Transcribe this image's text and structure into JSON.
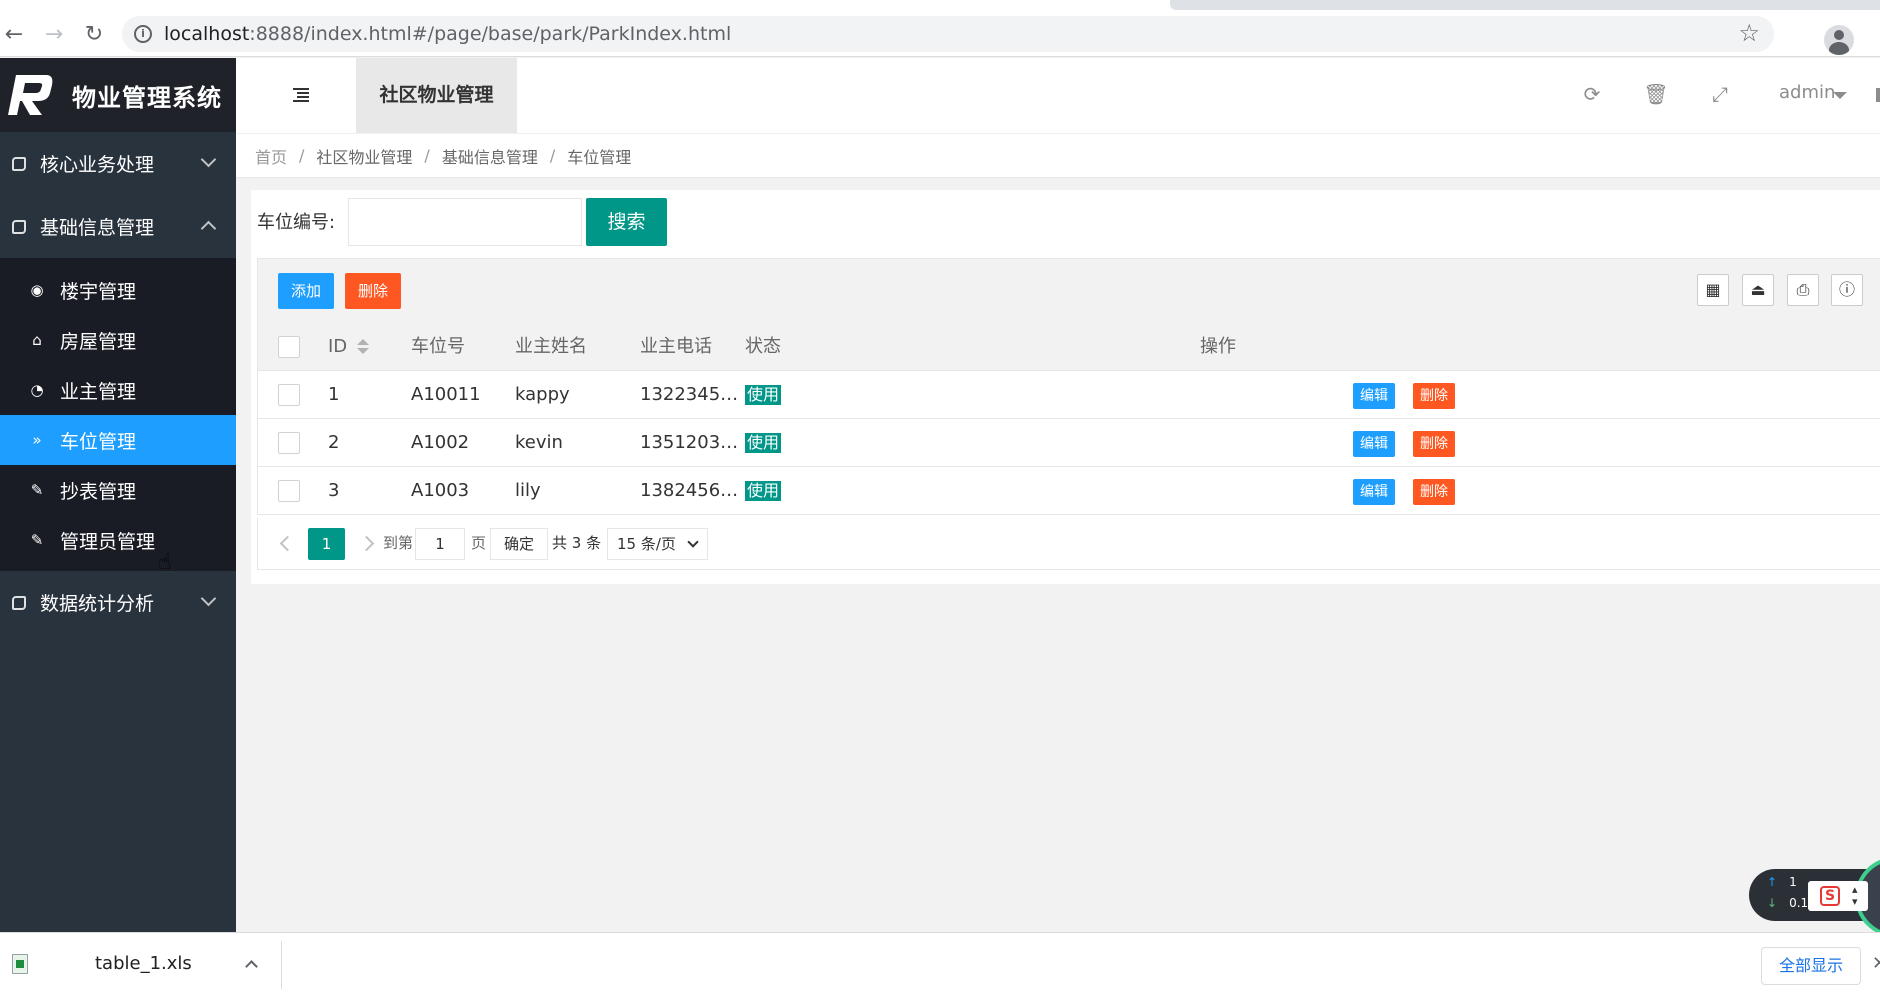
{
  "browser": {
    "url_host": "localhost",
    "url_path": ":8888/index.html#/page/base/park/ParkIndex.html",
    "back_icon": "arrow-left-icon",
    "forward_icon": "arrow-right-icon",
    "reload_icon": "reload-icon"
  },
  "app": {
    "title": "物业管理系统",
    "accent": "#1e9fff",
    "primary": "#009688",
    "danger": "#ff5722"
  },
  "sidebar": {
    "groups": [
      {
        "label": "核心业务处理",
        "expanded": false
      },
      {
        "label": "基础信息管理",
        "expanded": true
      },
      {
        "label": "数据统计分析",
        "expanded": false
      }
    ],
    "sub_items": [
      {
        "label": "楼宇管理",
        "icon": "target-icon"
      },
      {
        "label": "房屋管理",
        "icon": "home-icon"
      },
      {
        "label": "业主管理",
        "icon": "gauge-icon"
      },
      {
        "label": "车位管理",
        "icon": "chevron-down-icon",
        "active": true
      },
      {
        "label": "抄表管理",
        "icon": "edit-icon"
      },
      {
        "label": "管理员管理",
        "icon": "edit-icon"
      }
    ]
  },
  "header": {
    "tab": "社区物业管理",
    "user": "admin"
  },
  "breadcrumb": [
    "首页",
    "社区物业管理",
    "基础信息管理",
    "车位管理"
  ],
  "search": {
    "label": "车位编号:",
    "value": "",
    "button": "搜索"
  },
  "toolbar": {
    "add": "添加",
    "delete": "删除"
  },
  "table": {
    "columns": [
      "ID",
      "车位号",
      "业主姓名",
      "业主电话",
      "状态",
      "操作"
    ],
    "rows": [
      {
        "id": "1",
        "park_no": "A10011",
        "owner": "kappy",
        "phone": "1322345…",
        "status": "使用"
      },
      {
        "id": "2",
        "park_no": "A1002",
        "owner": "kevin",
        "phone": "1351203…",
        "status": "使用"
      },
      {
        "id": "3",
        "park_no": "A1003",
        "owner": "lily",
        "phone": "1382456…",
        "status": "使用"
      }
    ],
    "edit_label": "编辑",
    "delete_label": "删除"
  },
  "pager": {
    "current": "1",
    "goto": "到第",
    "page_input": "1",
    "page_unit": "页",
    "confirm": "确定",
    "total": "共 3 条",
    "per_page": "15 条/页"
  },
  "net_widget": {
    "up": "1",
    "down": "0.1"
  },
  "download_bar": {
    "file": "table_1.xls",
    "show_all": "全部显示"
  }
}
